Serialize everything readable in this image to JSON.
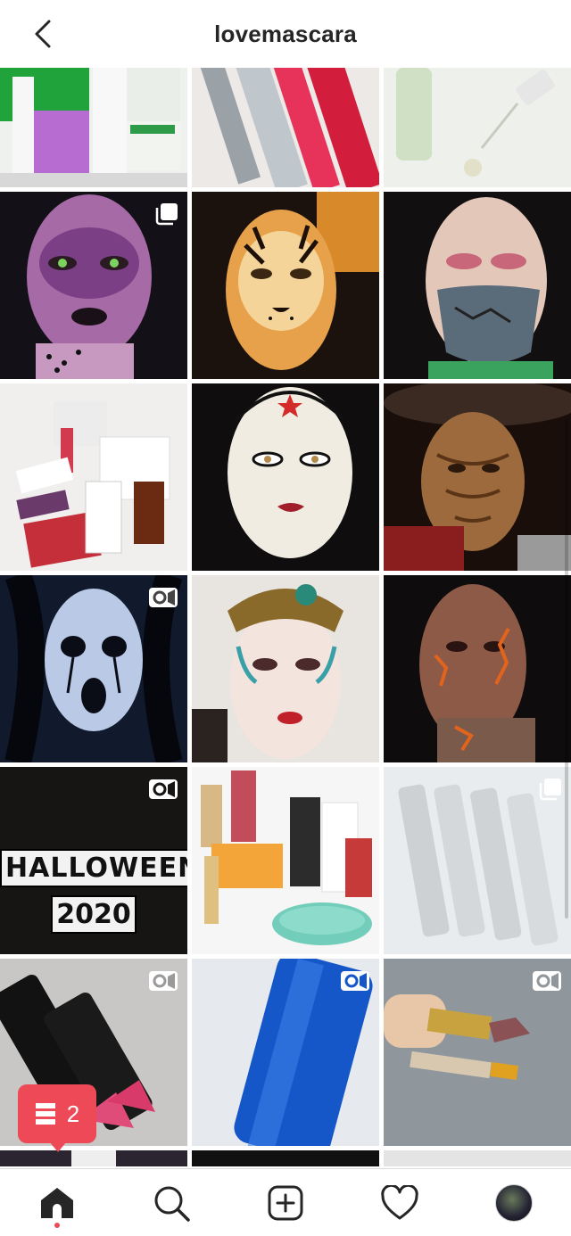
{
  "header": {
    "title": "lovemascara",
    "back_icon": "chevron-left-icon"
  },
  "grid": {
    "rows": [
      [
        {
          "name": "post-skincare-products",
          "badge": ""
        },
        {
          "name": "post-lip-pencils",
          "badge": ""
        },
        {
          "name": "post-osea-serum",
          "badge": ""
        }
      ],
      [
        {
          "name": "post-purple-leopard-makeup",
          "badge": "carousel"
        },
        {
          "name": "post-tiger-makeup",
          "badge": ""
        },
        {
          "name": "post-mask-makeup",
          "badge": ""
        }
      ],
      [
        {
          "name": "post-beauty-products-flatlay",
          "badge": ""
        },
        {
          "name": "post-pop-art-makeup",
          "badge": ""
        },
        {
          "name": "post-witch-wood-makeup",
          "badge": ""
        }
      ],
      [
        {
          "name": "post-ghost-makeup",
          "badge": "video"
        },
        {
          "name": "post-medusa-makeup",
          "badge": ""
        },
        {
          "name": "post-cracked-skin-makeup",
          "badge": ""
        }
      ],
      [
        {
          "name": "post-halloween-2020",
          "badge": "video"
        },
        {
          "name": "post-makeup-collection",
          "badge": ""
        },
        {
          "name": "post-brow-defining-boost",
          "badge": "carousel"
        }
      ],
      [
        {
          "name": "post-pink-lipsticks",
          "badge": "video"
        },
        {
          "name": "post-algenist-serum",
          "badge": "video"
        },
        {
          "name": "post-lipstick-swatch",
          "badge": "video"
        }
      ]
    ],
    "halloween_line1": "HALLOWEEN",
    "halloween_line2": "2020"
  },
  "notification": {
    "count": "2",
    "icon": "feed-stack-icon"
  },
  "bottom_nav": {
    "items": [
      {
        "name": "home",
        "icon": "home-icon",
        "active": true
      },
      {
        "name": "search",
        "icon": "search-icon",
        "active": false
      },
      {
        "name": "create",
        "icon": "plus-square-icon",
        "active": false
      },
      {
        "name": "activity",
        "icon": "heart-icon",
        "active": false
      },
      {
        "name": "profile",
        "icon": "avatar",
        "active": false
      }
    ]
  },
  "colors": {
    "accent_red": "#ed4956",
    "text_primary": "#262626"
  }
}
